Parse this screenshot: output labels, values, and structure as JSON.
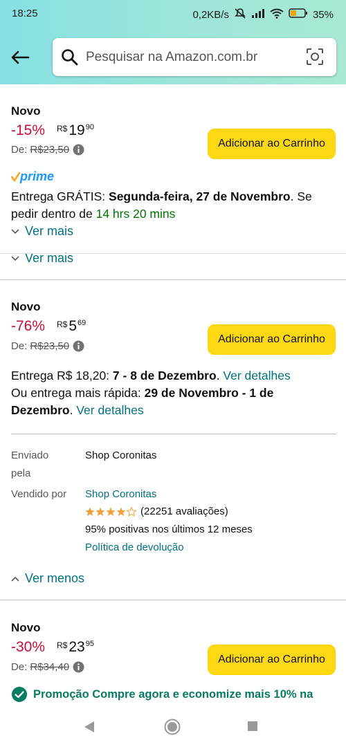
{
  "status": {
    "time": "18:25",
    "speed": "0,2KB/s",
    "battery": "35%"
  },
  "search": {
    "placeholder": "Pesquisar na Amazon.com.br"
  },
  "offers": [
    {
      "condition": "Novo",
      "discount": "-15%",
      "currency": "R$",
      "price_int": "19",
      "price_cents": "90",
      "was_label": "De:",
      "was_price": "R$23,50",
      "button": "Adicionar ao Carrinho",
      "prime": "prime",
      "delivery_prefix": "Entrega GRÁTIS: ",
      "delivery_date": "Segunda-feira, 27 de Novembro",
      "delivery_mid": ". Se pedir dentro de ",
      "delivery_window": "14 hrs 20 mins",
      "ver_mais": "Ver mais",
      "ver_mais_2": "Ver mais"
    },
    {
      "condition": "Novo",
      "discount": "-76%",
      "currency": "R$",
      "price_int": "5",
      "price_cents": "69",
      "was_label": "De:",
      "was_price": "R$23,50",
      "button": "Adicionar ao Carrinho",
      "delivery1_prefix": "Entrega R$ 18,20: ",
      "delivery1_date": "7 - 8 de Dezembro",
      "delivery1_link": "Ver detalhes",
      "delivery2_prefix": "Ou entrega mais rápida: ",
      "delivery2_date": "29 de Novembro - 1 de Dezembro",
      "delivery2_link": "Ver detalhes",
      "shipped_by_label": "Enviado pela",
      "shipped_by": "Shop Coronitas",
      "sold_by_label": "Vendido por",
      "sold_by": "Shop Coronitas",
      "rating": 4.5,
      "reviews": "(22251 avaliações)",
      "positive": "95% positivas nos últimos 12 meses",
      "return_policy": "Política de devolução",
      "ver_menos": "Ver menos"
    },
    {
      "condition": "Novo",
      "discount": "-30%",
      "currency": "R$",
      "price_int": "23",
      "price_cents": "95",
      "was_label": "De:",
      "was_price": "R$34,40",
      "button": "Adicionar ao Carrinho",
      "promo": "Promoção Compre agora e economize mais 10% na"
    }
  ],
  "colors": {
    "accent": "#ffd814",
    "discount": "#cc0c39",
    "link": "#007185",
    "green": "#007600",
    "prime": "#1a98ff"
  }
}
